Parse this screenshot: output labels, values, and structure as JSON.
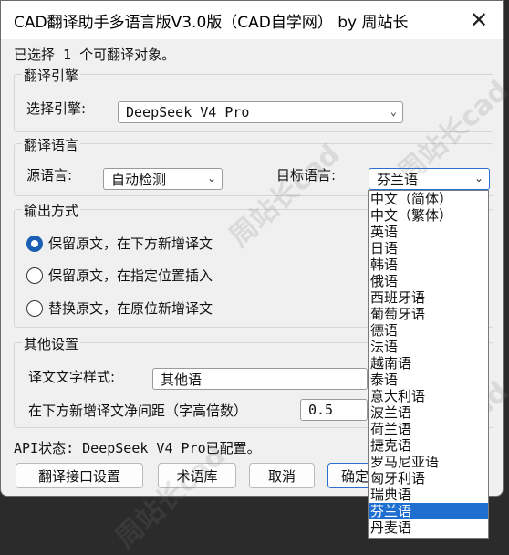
{
  "window": {
    "title": "CAD翻译助手多语言版V3.0版（CAD自学网） by 周站长",
    "close_glyph": "✕"
  },
  "status_selection": "已选择 1 个可翻译对象。",
  "engine_group": {
    "title": "翻译引擎",
    "label": "选择引擎:",
    "value": "DeepSeek V4 Pro"
  },
  "language_group": {
    "title": "翻译语言",
    "source_label": "源语言:",
    "source_value": "自动检测",
    "target_label": "目标语言:",
    "target_value": "芬兰语"
  },
  "output_group": {
    "title": "输出方式",
    "options": [
      {
        "label": "保留原文，在下方新增译文",
        "checked": true
      },
      {
        "label": "保留原文，在指定位置插入",
        "checked": false
      },
      {
        "label": "替换原文，在原位新增译文",
        "checked": false
      }
    ]
  },
  "other_group": {
    "title": "其他设置",
    "style_label": "译文文字样式:",
    "style_value": "其他语",
    "spacing_label": "在下方新增译文净间距（字高倍数）",
    "spacing_value": "0.5"
  },
  "api_status": "API状态: DeepSeek V4 Pro已配置。",
  "buttons": {
    "interface_settings": "翻译接口设置",
    "glossary": "术语库",
    "cancel": "取消",
    "confirm": "确定"
  },
  "target_dropdown": {
    "items": [
      "中文（简体）",
      "中文（繁体）",
      "英语",
      "日语",
      "韩语",
      "俄语",
      "西班牙语",
      "葡萄牙语",
      "德语",
      "法语",
      "越南语",
      "泰语",
      "意大利语",
      "波兰语",
      "荷兰语",
      "捷克语",
      "罗马尼亚语",
      "匈牙利语",
      "瑞典语",
      "芬兰语",
      "丹麦语"
    ],
    "selected_index": 19
  },
  "colors": {
    "accent": "#1f6fd1",
    "window_bg": "#f0f0f0",
    "backdrop": "#2b2b2b"
  },
  "watermark": "周站长cad"
}
